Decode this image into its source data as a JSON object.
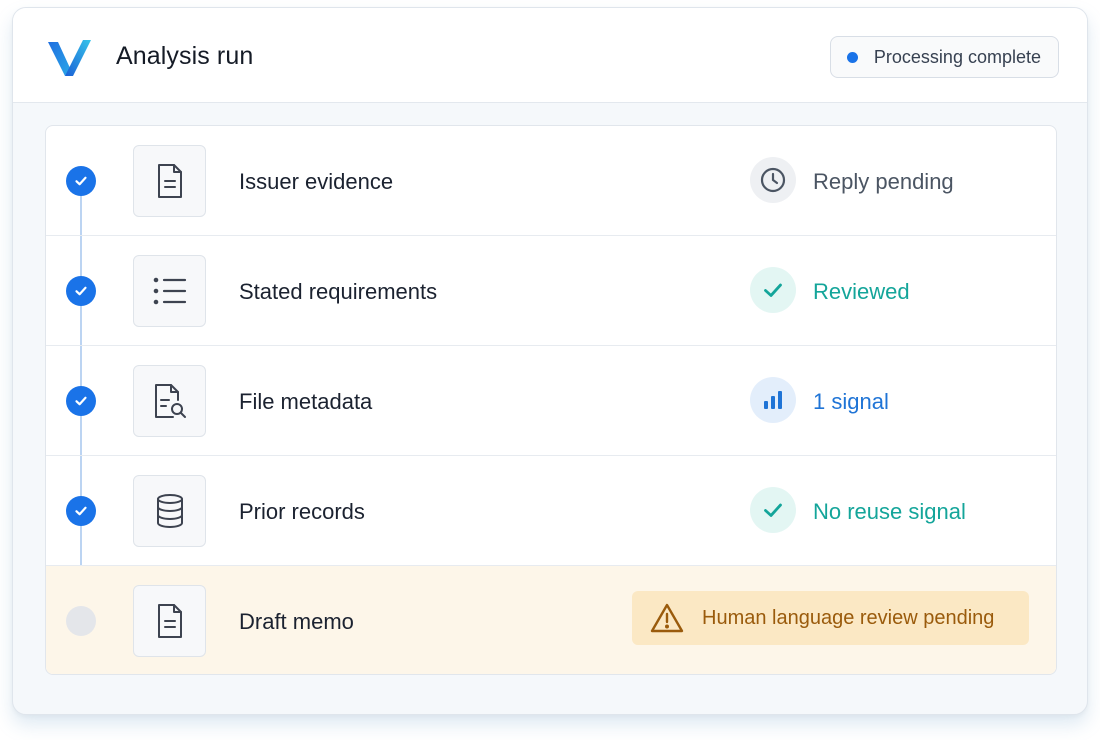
{
  "header": {
    "title": "Analysis run",
    "logo_icon": "v-logo-icon",
    "status": {
      "label": "Processing complete",
      "dot_color": "#1a73e8"
    }
  },
  "steps": [
    {
      "label": "Issuer evidence",
      "step_state": "complete",
      "icon": "document-icon",
      "status": {
        "text": "Reply pending",
        "icon": "clock-icon",
        "color": "#4b5563",
        "bg": "#eef0f3"
      }
    },
    {
      "label": "Stated requirements",
      "step_state": "complete",
      "icon": "list-icon",
      "status": {
        "text": "Reviewed",
        "icon": "check-icon",
        "color": "#14a59a",
        "bg": "#e3f6f3"
      }
    },
    {
      "label": "File metadata",
      "step_state": "complete",
      "icon": "file-search-icon",
      "status": {
        "text": "1 signal",
        "icon": "bar-chart-icon",
        "color": "#1f74d6",
        "bg": "#e3eefb"
      }
    },
    {
      "label": "Prior records",
      "step_state": "complete",
      "icon": "database-icon",
      "status": {
        "text": "No reuse signal",
        "icon": "check-icon",
        "color": "#14a59a",
        "bg": "#e3f6f3"
      }
    },
    {
      "label": "Draft memo",
      "step_state": "pending",
      "icon": "document-icon",
      "status": {
        "text": "Human language review pending",
        "icon": "warning-icon",
        "color": "#9a5b0c",
        "bg": "#fbe8c4"
      }
    }
  ]
}
